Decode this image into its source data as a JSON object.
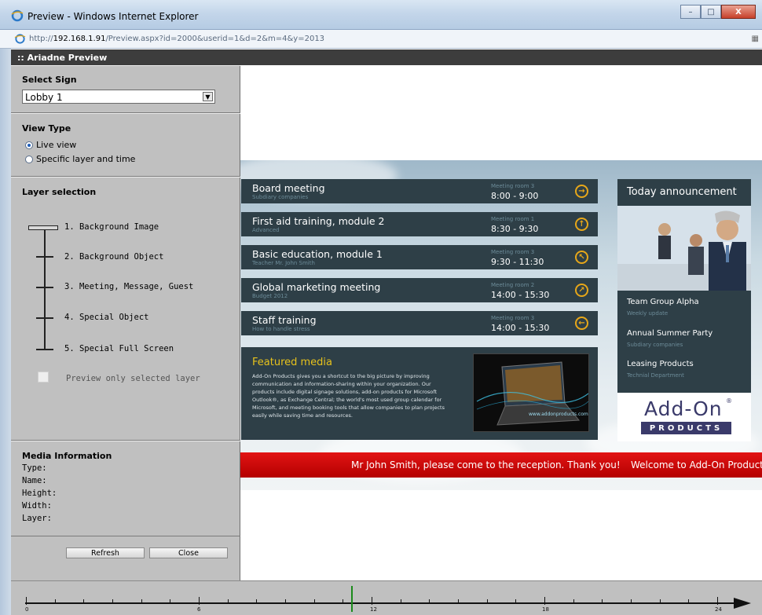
{
  "window": {
    "title": "Preview - Windows Internet Explorer",
    "url_prefix": "http://",
    "url_host": "192.168.1.91",
    "url_path": "/Preview.aspx?id=2000&userid=1&d=2&m=4&y=2013",
    "min_label": "–",
    "max_label": "□",
    "close_label": "X"
  },
  "app": {
    "header": ":: Ariadne Preview"
  },
  "select_sign": {
    "title": "Select Sign",
    "value": "Lobby 1"
  },
  "view_type": {
    "title": "View Type",
    "options": [
      {
        "label": "Live view",
        "selected": true
      },
      {
        "label": "Specific layer and time",
        "selected": false
      }
    ]
  },
  "layer_selection": {
    "title": "Layer selection",
    "layers": [
      "1. Background Image",
      "2. Background Object",
      "3. Meeting, Message, Guest",
      "4. Special Object",
      "5. Special Full Screen"
    ],
    "selected_layer": "1. Background Image",
    "preview_only_label": "Preview only selected layer",
    "preview_only_checked": false
  },
  "media_info": {
    "title": "Media Information",
    "fields": [
      "Type:",
      "Name:",
      "Height:",
      "Width:",
      "Layer:"
    ]
  },
  "buttons": {
    "refresh": "Refresh",
    "close": "Close"
  },
  "sign": {
    "meetings": [
      {
        "title": "Board meeting",
        "sub": "Subdiary companies",
        "room": "Meeting room 3",
        "time": "8:00 - 9:00",
        "icon": "arrow-right-icon",
        "glyph": "→"
      },
      {
        "title": "First aid training, module 2",
        "sub": "Advanced",
        "room": "Meeting room 1",
        "time": "8:30 - 9:30",
        "icon": "arrow-up-icon",
        "glyph": "↑"
      },
      {
        "title": "Basic education, module 1",
        "sub": "Teacher Mr. John Smith",
        "room": "Meeting room 3",
        "time": "9:30 - 11:30",
        "icon": "arrow-up-left-icon",
        "glyph": "↖"
      },
      {
        "title": "Global marketing meeting",
        "sub": "Budget 2012",
        "room": "Meeting room 2",
        "time": "14:00 - 15:30",
        "icon": "arrow-up-right-icon",
        "glyph": "↗"
      },
      {
        "title": "Staff training",
        "sub": "How to handle stress",
        "room": "Meeting room 3",
        "time": "14:00 - 15:30",
        "icon": "arrow-left-icon",
        "glyph": "←"
      }
    ],
    "featured": {
      "title": "Featured media",
      "body": "Add-On Products gives you a shortcut to the big picture by improving communication and information-sharing within your organization. Our products include digital signage solutions, add-on products for Microsoft Outlook®, as Exchange Central; the world's most used group calendar for Microsoft, and meeting booking tools that allow companies to plan projects easily while saving time and resources.",
      "image_caption": "www.addonproducts.com"
    },
    "announcement": {
      "title": "Today announcement",
      "items": [
        {
          "title": "Team Group Alpha",
          "sub": "Weekly update"
        },
        {
          "title": "Annual Summer Party",
          "sub": "Subdiary companies"
        },
        {
          "title": "Leasing Products",
          "sub": "Technial Department"
        }
      ],
      "logo_top": "Add-On",
      "logo_reg": "®",
      "logo_bottom": "PRODUCTS"
    },
    "ticker": [
      "Mr John Smith, please come to the reception. Thank you!",
      "Welcome to Add-On Products"
    ]
  },
  "timeline": {
    "labels": [
      "0",
      "6",
      "12",
      "18",
      "24"
    ],
    "current_hour": 11.3
  }
}
